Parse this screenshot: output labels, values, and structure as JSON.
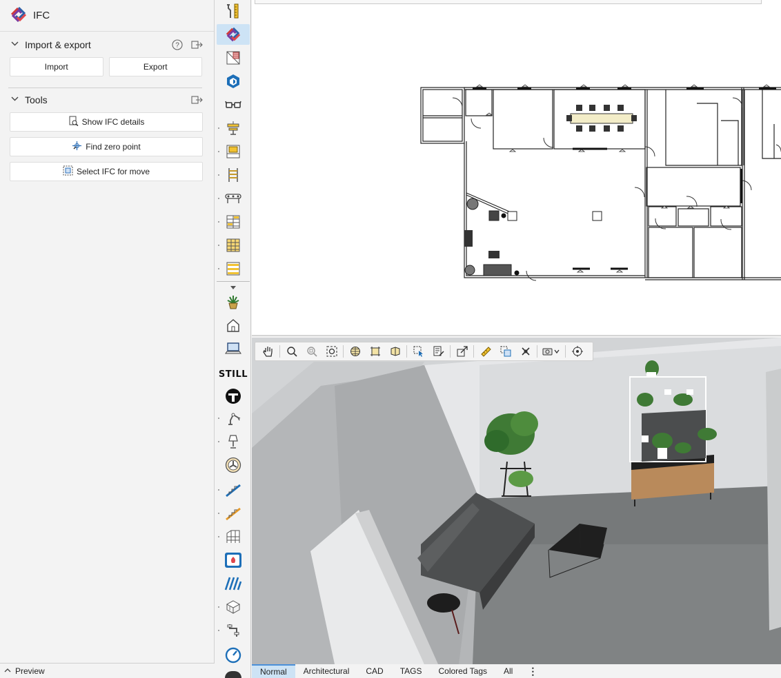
{
  "panel": {
    "title": "IFC",
    "logo_icon": "ifc-logo-icon"
  },
  "sections": {
    "import_export": {
      "title": "Import & export",
      "import_label": "Import",
      "export_label": "Export"
    },
    "tools": {
      "title": "Tools",
      "show_details_label": "Show IFC details",
      "find_zero_label": "Find zero point",
      "select_move_label": "Select IFC for move"
    }
  },
  "preview": {
    "label": "Preview"
  },
  "toolbar_icons": [
    "wrench-ruler-icon",
    "ifc-icon",
    "wall-icon",
    "sketchup-icon",
    "glasses-icon",
    "hanging-light-icon",
    "door-frame-icon",
    "ladder-icon",
    "conveyor-icon",
    "shelving-icon",
    "shelf-grid-icon",
    "pallet-rack-icon",
    "plant-icon",
    "home-icon",
    "laptop-icon",
    "still-logo",
    "t-logo-icon",
    "robot-arm-icon",
    "lamp-icon",
    "fan-icon",
    "stairs-blue-icon",
    "stairs-orange-icon",
    "storage-rack-icon",
    "fire-extinguisher-icon",
    "stripes-icon",
    "box-stack-icon",
    "pipe-icon",
    "gauge-icon"
  ],
  "still_text": "STILL",
  "view_toolbar_icons": [
    "pan-hand-icon",
    "zoom-icon",
    "zoom-region-icon",
    "zoom-extents-icon",
    "globe-icon",
    "bounding-box-icon",
    "perspective-icon",
    "select-arrow-icon",
    "edit-list-icon",
    "resize-icon",
    "measure-ruler-icon",
    "clone-icon",
    "delete-icon",
    "camera-icon",
    "target-icon"
  ],
  "tabs": [
    {
      "label": "Normal",
      "active": true
    },
    {
      "label": "Architectural",
      "active": false
    },
    {
      "label": "CAD",
      "active": false
    },
    {
      "label": "TAGS",
      "active": false
    },
    {
      "label": "Colored Tags",
      "active": false
    },
    {
      "label": "All",
      "active": false
    }
  ],
  "colors": {
    "accent": "#cde3f5",
    "tab_border": "#4a90d9",
    "panel_bg": "#f3f3f3"
  }
}
